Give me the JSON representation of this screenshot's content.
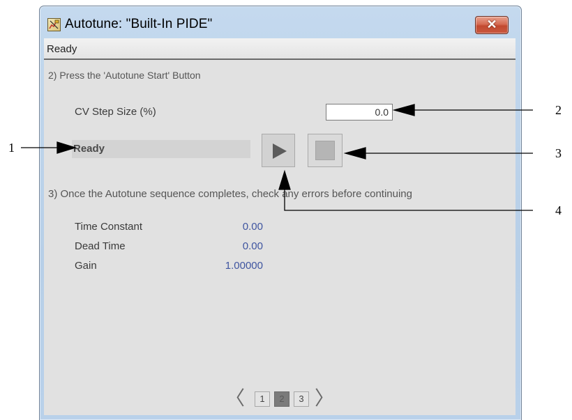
{
  "window": {
    "title": "Autotune:  \"Built-In PIDE\"",
    "close_label": "✕",
    "status_text": "Ready"
  },
  "step2": {
    "title": "2) Press the 'Autotune Start' Button",
    "cv_step_label": "CV Step Size (%)",
    "cv_step_value": "0.0",
    "state_text": "Ready"
  },
  "step3": {
    "title": "3) Once the Autotune sequence completes, check any errors before continuing",
    "rows": [
      {
        "label": "Time Constant",
        "value": "0.00"
      },
      {
        "label": "Dead Time",
        "value": "0.00"
      },
      {
        "label": "Gain",
        "value": "1.00000"
      }
    ]
  },
  "pager": {
    "prev": "〈",
    "next": "〉",
    "pages": [
      "1",
      "2",
      "3"
    ],
    "current_page": "2"
  },
  "callouts": [
    "1",
    "2",
    "3",
    "4"
  ],
  "colors": {
    "window_frame": "#b9d1ea",
    "close_button": "#c9583e",
    "content_bg": "#e1e1e1",
    "value_text": "#3f55a0"
  },
  "icons": {
    "title": "autotune-app-icon",
    "close": "close-icon",
    "start": "play-icon",
    "stop": "stop-icon",
    "prev": "chevron-left-icon",
    "next": "chevron-right-icon"
  }
}
